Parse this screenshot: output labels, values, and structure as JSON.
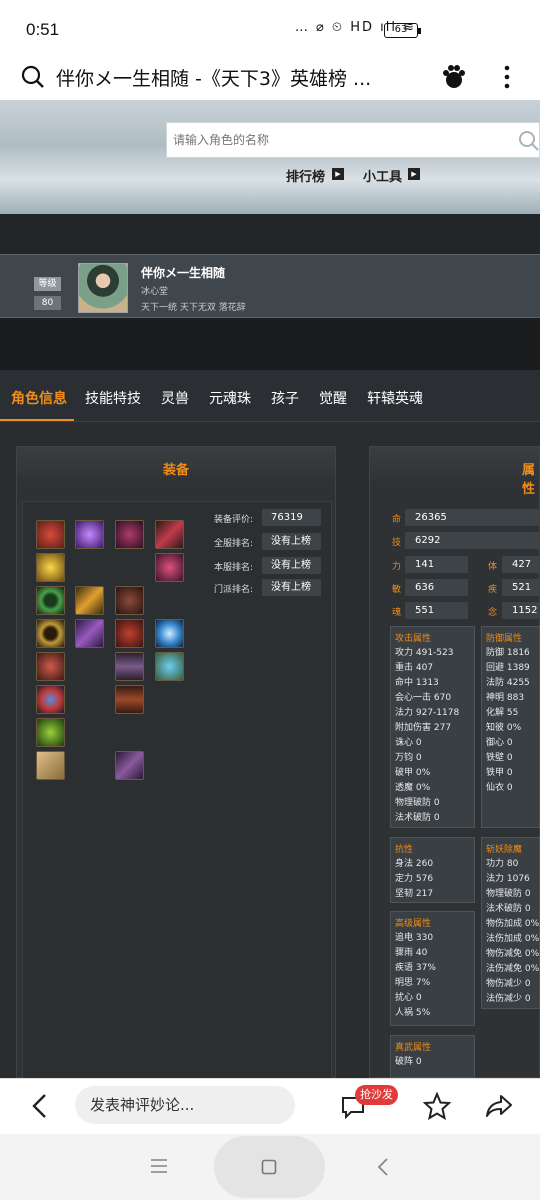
{
  "status": {
    "time": "0:51",
    "icons": "… ⌀ ⏲ HD ıll ≋",
    "battery": "63"
  },
  "topbar": {
    "title": "伴你メ一生相随 -《天下3》英雄榜 ..."
  },
  "site": {
    "search_placeholder": "请输入角色的名称",
    "nav": [
      "排行榜",
      "小工具"
    ]
  },
  "character": {
    "level_label": "等级",
    "level": "80",
    "name": "伴你メ一生相随",
    "guild": "冰心堂",
    "titles": "天下一统 天下无双 落花辞"
  },
  "tabs": [
    "角色信息",
    "技能特技",
    "灵兽",
    "元魂珠",
    "孩子",
    "觉醒",
    "轩辕英魂"
  ],
  "equip_panel": {
    "title": "装备",
    "ratings": [
      {
        "label": "装备评价:",
        "value": "76319"
      },
      {
        "label": "全服排名:",
        "value": "没有上榜"
      },
      {
        "label": "本服排名:",
        "value": "没有上榜"
      },
      {
        "label": "门派排名:",
        "value": "没有上榜"
      }
    ]
  },
  "attr_panel": {
    "title": "属性",
    "main": [
      {
        "label": "命",
        "value": "26365"
      },
      {
        "label": "技",
        "value": "6292"
      }
    ],
    "pairs": [
      {
        "l1": "力",
        "v1": "141",
        "l2": "体",
        "v2": "427"
      },
      {
        "l1": "敏",
        "v1": "636",
        "l2": "疾",
        "v2": "521"
      },
      {
        "l1": "魂",
        "v1": "551",
        "l2": "念",
        "v2": "1152"
      }
    ],
    "attack": {
      "title": "攻击属性",
      "lines": [
        "攻力 491-523",
        "重击 407",
        "命中 1313",
        "会心一击 670",
        "法力 927-1178",
        "附加伤害 277",
        "诛心 0",
        "万钧 0",
        "破甲 0%",
        "透魔 0%",
        "物理破防 0",
        "法术破防 0"
      ]
    },
    "defense": {
      "title": "防御属性",
      "lines": [
        "防御 1816",
        "回避 1389",
        "法防 4255",
        "神明 883",
        "化解 55",
        "知彼 0%",
        "御心 0",
        "铁壁 0",
        "铁甲 0",
        "仙衣 0"
      ]
    },
    "resist": {
      "title": "抗性",
      "lines": [
        "身法 260",
        "定力 576",
        "坚韧 217"
      ]
    },
    "demon": {
      "title": "斩妖除魔",
      "lines": [
        "功力 80",
        "法力 1076",
        "物理破防 0",
        "法术破防 0",
        "物伤加成 0%",
        "法伤加成 0%",
        "物伤减免 0%",
        "法伤减免 0%",
        "物伤减少 0",
        "法伤减少 0"
      ]
    },
    "advanced": {
      "title": "高级属性",
      "lines": [
        "追电 330",
        "骤雨 40",
        "疾语 37%",
        "明思 7%",
        "扰心 0",
        "人祸 5%"
      ]
    },
    "zhenwu": {
      "title": "真武属性",
      "lines": [
        "破阵 0"
      ]
    }
  },
  "bottom": {
    "comment_placeholder": "发表神评妙论...",
    "badge": "抢沙发"
  },
  "colors": {
    "accent": "#f08c1a",
    "bg_dark": "#2a2d30",
    "badge": "#e03a3a"
  }
}
